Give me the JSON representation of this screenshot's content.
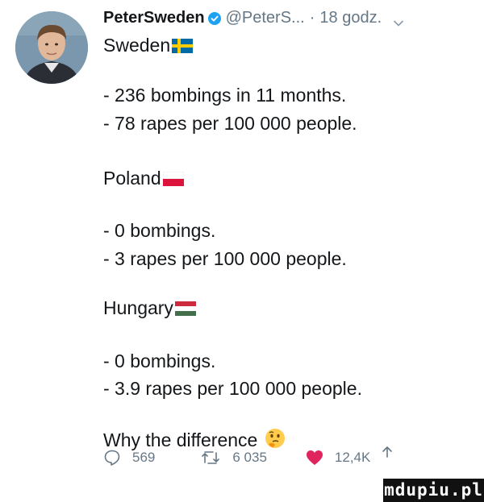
{
  "tweet": {
    "display_name": "PeterSweden",
    "handle": "@PeterS...",
    "separator": "·",
    "time": "18 godz.",
    "country_sections": [
      {
        "country": "Sweden",
        "flag": "sweden-flag-icon",
        "lines": [
          "- 236 bombings in 11 months.",
          "- 78 rapes per 100 000 people."
        ]
      },
      {
        "country": "Poland",
        "flag": "poland-flag-icon",
        "lines": [
          "- 0 bombings.",
          "- 3 rapes per 100 000 people."
        ]
      },
      {
        "country": "Hungary",
        "flag": "hungary-flag-icon",
        "lines": [
          "- 0 bombings.",
          "- 3.9 rapes per 100 000 people."
        ]
      }
    ],
    "closing": "Why the difference",
    "closing_emoji": "thinking-face-emoji"
  },
  "actions": {
    "reply_count": "569",
    "retweet_count": "6 035",
    "like_count": "12,4K"
  },
  "watermark": "mdupiu.pl",
  "colors": {
    "text": "#14171a",
    "muted": "#657786",
    "verified": "#1da1f2",
    "like": "#e0245e"
  }
}
